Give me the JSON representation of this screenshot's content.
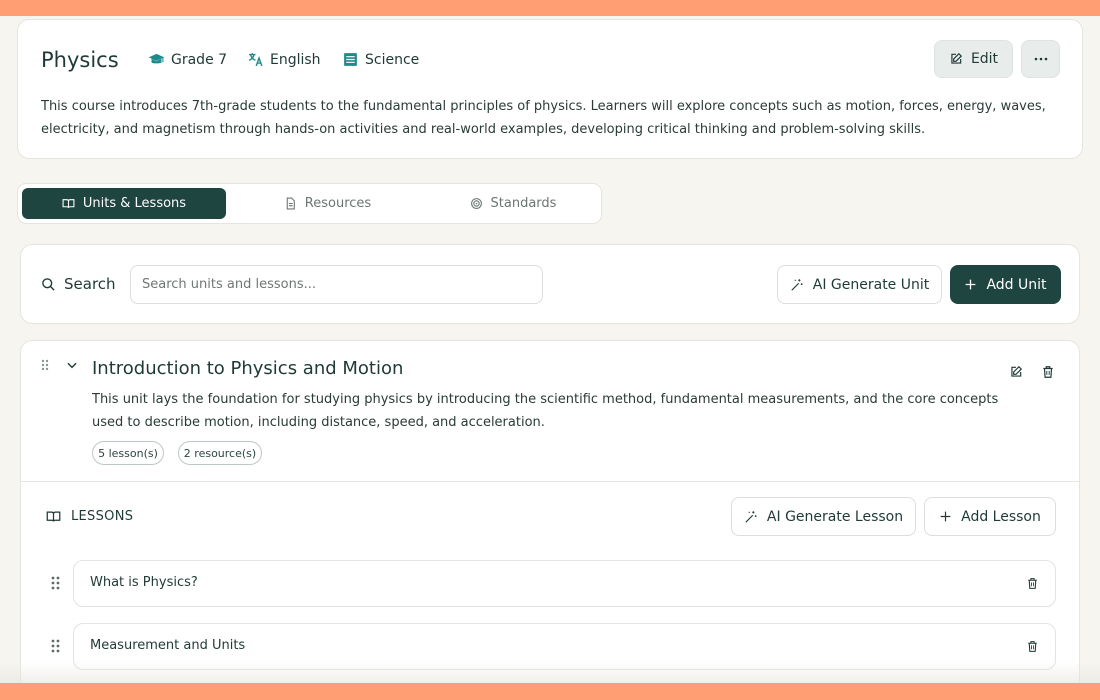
{
  "course": {
    "title": "Physics",
    "grade": "Grade 7",
    "language": "English",
    "subject": "Science",
    "edit_label": "Edit",
    "description": "This course introduces 7th-grade students to the fundamental principles of physics. Learners will explore concepts such as motion, forces, energy, waves, electricity, and magnetism through hands-on activities and real-world examples, developing critical thinking and problem-solving skills."
  },
  "tabs": [
    {
      "label": "Units & Lessons",
      "active": true
    },
    {
      "label": "Resources",
      "active": false
    },
    {
      "label": "Standards",
      "active": false
    }
  ],
  "search": {
    "label": "Search",
    "placeholder": "Search units and lessons...",
    "value": "",
    "ai_generate_unit_label": "AI Generate Unit",
    "add_unit_label": "Add Unit"
  },
  "unit": {
    "title": "Introduction to Physics and Motion",
    "description": "This unit lays the foundation for studying physics by introducing the scientific method, fundamental measurements, and the core concepts used to describe motion, including distance, speed, and acceleration.",
    "lessons_badge": "5 lesson(s)",
    "resources_badge": "2 resource(s)",
    "lessons_heading": "LESSONS",
    "ai_generate_lesson_label": "AI Generate Lesson",
    "add_lesson_label": "Add Lesson",
    "lessons": [
      {
        "title": "What is Physics?"
      },
      {
        "title": "Measurement and Units"
      }
    ]
  },
  "colors": {
    "primary": "#1e4540",
    "accent_bar": "#ff9d73",
    "background": "#f7f5f0",
    "icon_teal": "#1f8a8a"
  }
}
